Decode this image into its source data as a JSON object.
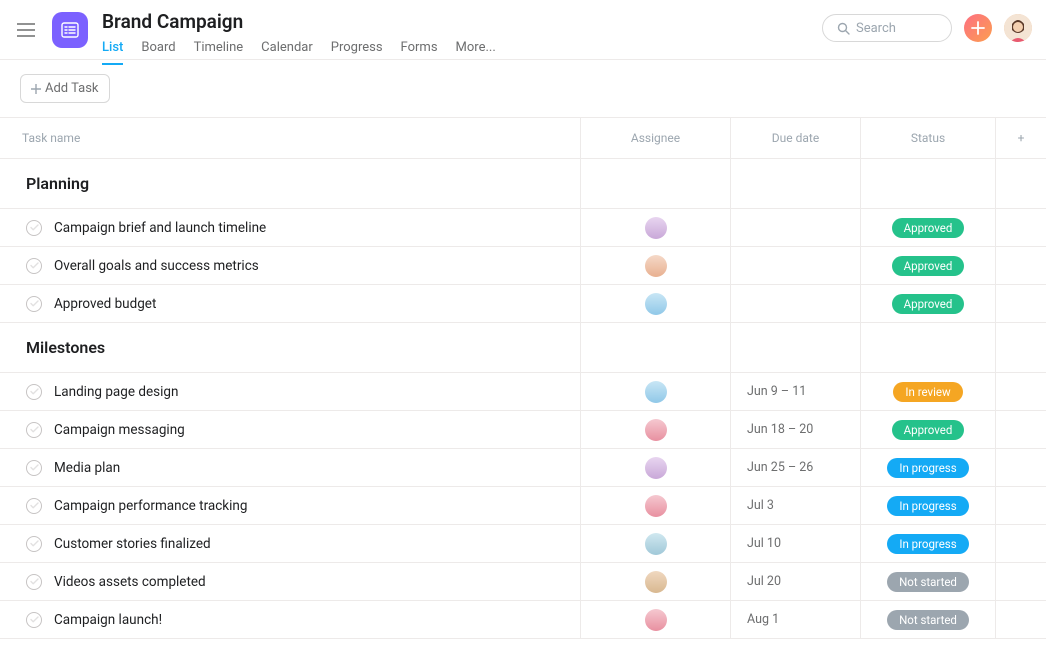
{
  "header": {
    "title": "Brand Campaign",
    "search_placeholder": "Search"
  },
  "tabs": [
    {
      "label": "List",
      "active": true
    },
    {
      "label": "Board"
    },
    {
      "label": "Timeline"
    },
    {
      "label": "Calendar"
    },
    {
      "label": "Progress"
    },
    {
      "label": "Forms"
    },
    {
      "label": "More..."
    }
  ],
  "toolbar": {
    "add_task_label": "Add Task"
  },
  "columns": {
    "name": "Task name",
    "assignee": "Assignee",
    "due": "Due date",
    "status": "Status",
    "add": "+"
  },
  "statuses": {
    "approved": {
      "label": "Approved",
      "class": "status-approved"
    },
    "in_review": {
      "label": "In review",
      "class": "status-inreview"
    },
    "in_progress": {
      "label": "In progress",
      "class": "status-inprogress"
    },
    "not_started": {
      "label": "Not started",
      "class": "status-notstarted"
    }
  },
  "sections": [
    {
      "name": "Planning",
      "tasks": [
        {
          "name": "Campaign brief and launch timeline",
          "assignee_class": "av1",
          "due": "",
          "status": "approved"
        },
        {
          "name": "Overall goals and success metrics",
          "assignee_class": "av2",
          "due": "",
          "status": "approved"
        },
        {
          "name": "Approved budget",
          "assignee_class": "av3",
          "due": "",
          "status": "approved"
        }
      ]
    },
    {
      "name": "Milestones",
      "tasks": [
        {
          "name": "Landing page design",
          "assignee_class": "av3",
          "due": "Jun 9 – 11",
          "status": "in_review"
        },
        {
          "name": "Campaign messaging",
          "assignee_class": "av4",
          "due": "Jun 18 – 20",
          "status": "approved"
        },
        {
          "name": "Media plan",
          "assignee_class": "av1",
          "due": "Jun 25 – 26",
          "status": "in_progress"
        },
        {
          "name": "Campaign performance tracking",
          "assignee_class": "av4",
          "due": "Jul 3",
          "status": "in_progress"
        },
        {
          "name": "Customer stories finalized",
          "assignee_class": "av5",
          "due": "Jul 10",
          "status": "in_progress"
        },
        {
          "name": "Videos assets completed",
          "assignee_class": "av6",
          "due": "Jul 20",
          "status": "not_started"
        },
        {
          "name": "Campaign launch!",
          "assignee_class": "av4",
          "due": "Aug 1",
          "status": "not_started"
        }
      ]
    }
  ]
}
